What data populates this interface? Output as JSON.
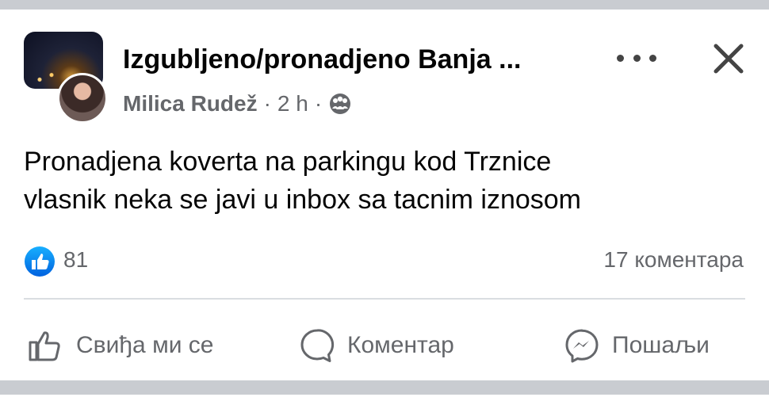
{
  "post": {
    "group_name": "Izgubljeno/pronadjeno Banja ...",
    "author": "Milica Rudež",
    "separator": "·",
    "time": "2 h",
    "text_lines": [
      "Pronadjena koverta na parkingu kod Trznice",
      "vlasnik neka se javi u inbox sa tacnim iznosom"
    ],
    "reactions": {
      "count": "81",
      "comments": "17 коментара"
    },
    "actions": {
      "like": "Свиђа ми се",
      "comment": "Коментар",
      "send": "Пошаљи"
    }
  },
  "icons": {
    "more": "more-horizontal-icon",
    "close": "close-icon",
    "audience": "group-audience-icon",
    "reaction": "like-reaction-icon",
    "like": "thumbs-up-icon",
    "comment": "comment-bubble-icon",
    "send": "messenger-icon"
  },
  "colors": {
    "accent": "#1877f2",
    "secondary_text": "#65676b",
    "primary_text": "#050505"
  }
}
